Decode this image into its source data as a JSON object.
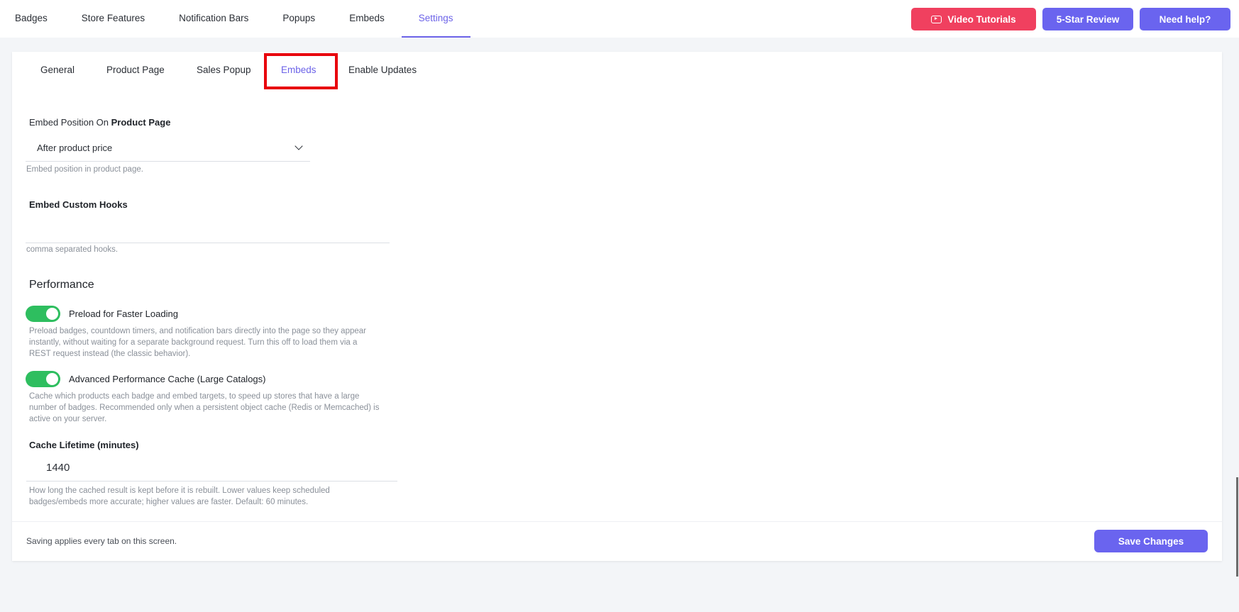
{
  "topnav": {
    "items": [
      "Badges",
      "Store Features",
      "Notification Bars",
      "Popups",
      "Embeds",
      "Settings"
    ],
    "active": "Settings"
  },
  "actions": {
    "video": "Video Tutorials",
    "review": "5-Star Review",
    "help": "Need help?"
  },
  "subtabs": {
    "items": [
      "General",
      "Product Page",
      "Sales Popup",
      "Embeds",
      "Enable Updates"
    ],
    "active": "Embeds"
  },
  "embed_position": {
    "label_prefix": "Embed Position On",
    "label_bold": "Product Page",
    "value": "After product price",
    "help": "Embed position in product page."
  },
  "custom_hooks": {
    "label": "Embed Custom Hooks",
    "value": "",
    "help": "comma separated hooks."
  },
  "performance": {
    "title": "Performance",
    "preload": {
      "label": "Preload for Faster Loading",
      "enabled": true,
      "help_line1": "Preload badges, countdown timers, and notification bars directly into the page so they appear",
      "help_line2": "instantly, without waiting for a separate background request. Turn this off to load them via a",
      "help_line3": "REST request instead (the classic behavior)."
    },
    "cache": {
      "label": "Advanced Performance Cache (Large Catalogs)",
      "enabled": true,
      "help_line1": "Cache which products each badge and embed targets, to speed up stores that have a large",
      "help_line2": "number of badges. Recommended only when a persistent object cache (Redis or Memcached) is",
      "help_line3": "active on your server."
    },
    "lifetime": {
      "label": "Cache Lifetime (minutes)",
      "value": "1440",
      "help_line1": "How long the cached result is kept before it is rebuilt. Lower values keep scheduled",
      "help_line2": "badges/embeds more accurate; higher values are faster. Default: 60 minutes."
    }
  },
  "footer": {
    "note": "Saving applies every tab on this screen.",
    "save": "Save Changes"
  },
  "colors": {
    "accent": "#6a64ef",
    "video_button": "#f0405f",
    "toggle_on": "#2ebe5f",
    "highlight": "#e8000b"
  }
}
